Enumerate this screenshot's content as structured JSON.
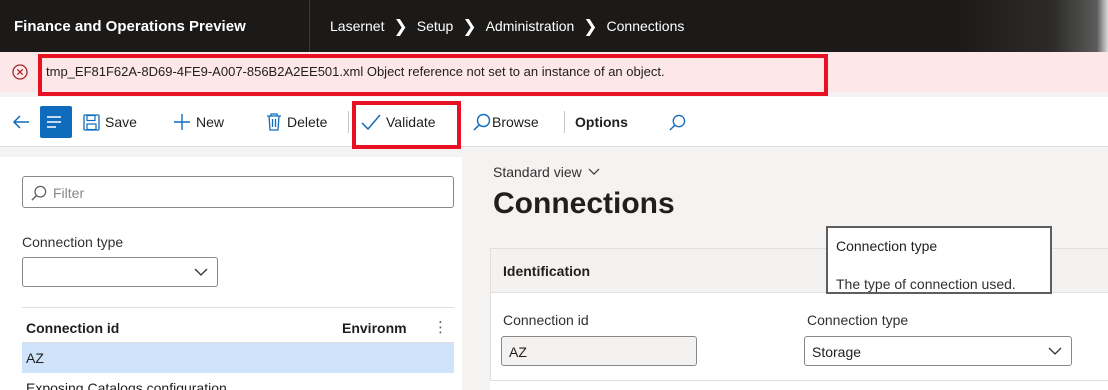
{
  "app": {
    "title": "Finance and Operations Preview"
  },
  "breadcrumb": [
    "Lasernet",
    "Setup",
    "Administration",
    "Connections"
  ],
  "message": {
    "text": "tmp_EF81F62A-8D69-4FE9-A007-856B2A2EE501.xml Object reference not set to an instance of an object.",
    "icon": "error-circle-icon",
    "severity_color": "#a4262c"
  },
  "actions": {
    "save": "Save",
    "new": "New",
    "delete": "Delete",
    "validate": "Validate",
    "browse": "Browse",
    "options": "Options"
  },
  "leftpane": {
    "filter_placeholder": "Filter",
    "connection_type_label": "Connection type",
    "connection_type_value": "",
    "grid": {
      "columns": [
        "Connection id",
        "Environm"
      ],
      "rows": [
        "AZ",
        "Exposing Catalogs configuration"
      ]
    }
  },
  "view": {
    "name": "Standard view"
  },
  "page": {
    "title": "Connections"
  },
  "identification": {
    "header": "Identification",
    "connection_id_label": "Connection id",
    "connection_id_value": "AZ",
    "connection_type_label": "Connection type",
    "connection_type_value": "Storage"
  },
  "tooltip": {
    "title": "Connection type",
    "body": "The type of connection used."
  },
  "colors": {
    "accent": "#0f6cbd",
    "highlight": "#e81123",
    "selected_row": "#cfe4fa",
    "message_bg": "#fde7e9"
  }
}
